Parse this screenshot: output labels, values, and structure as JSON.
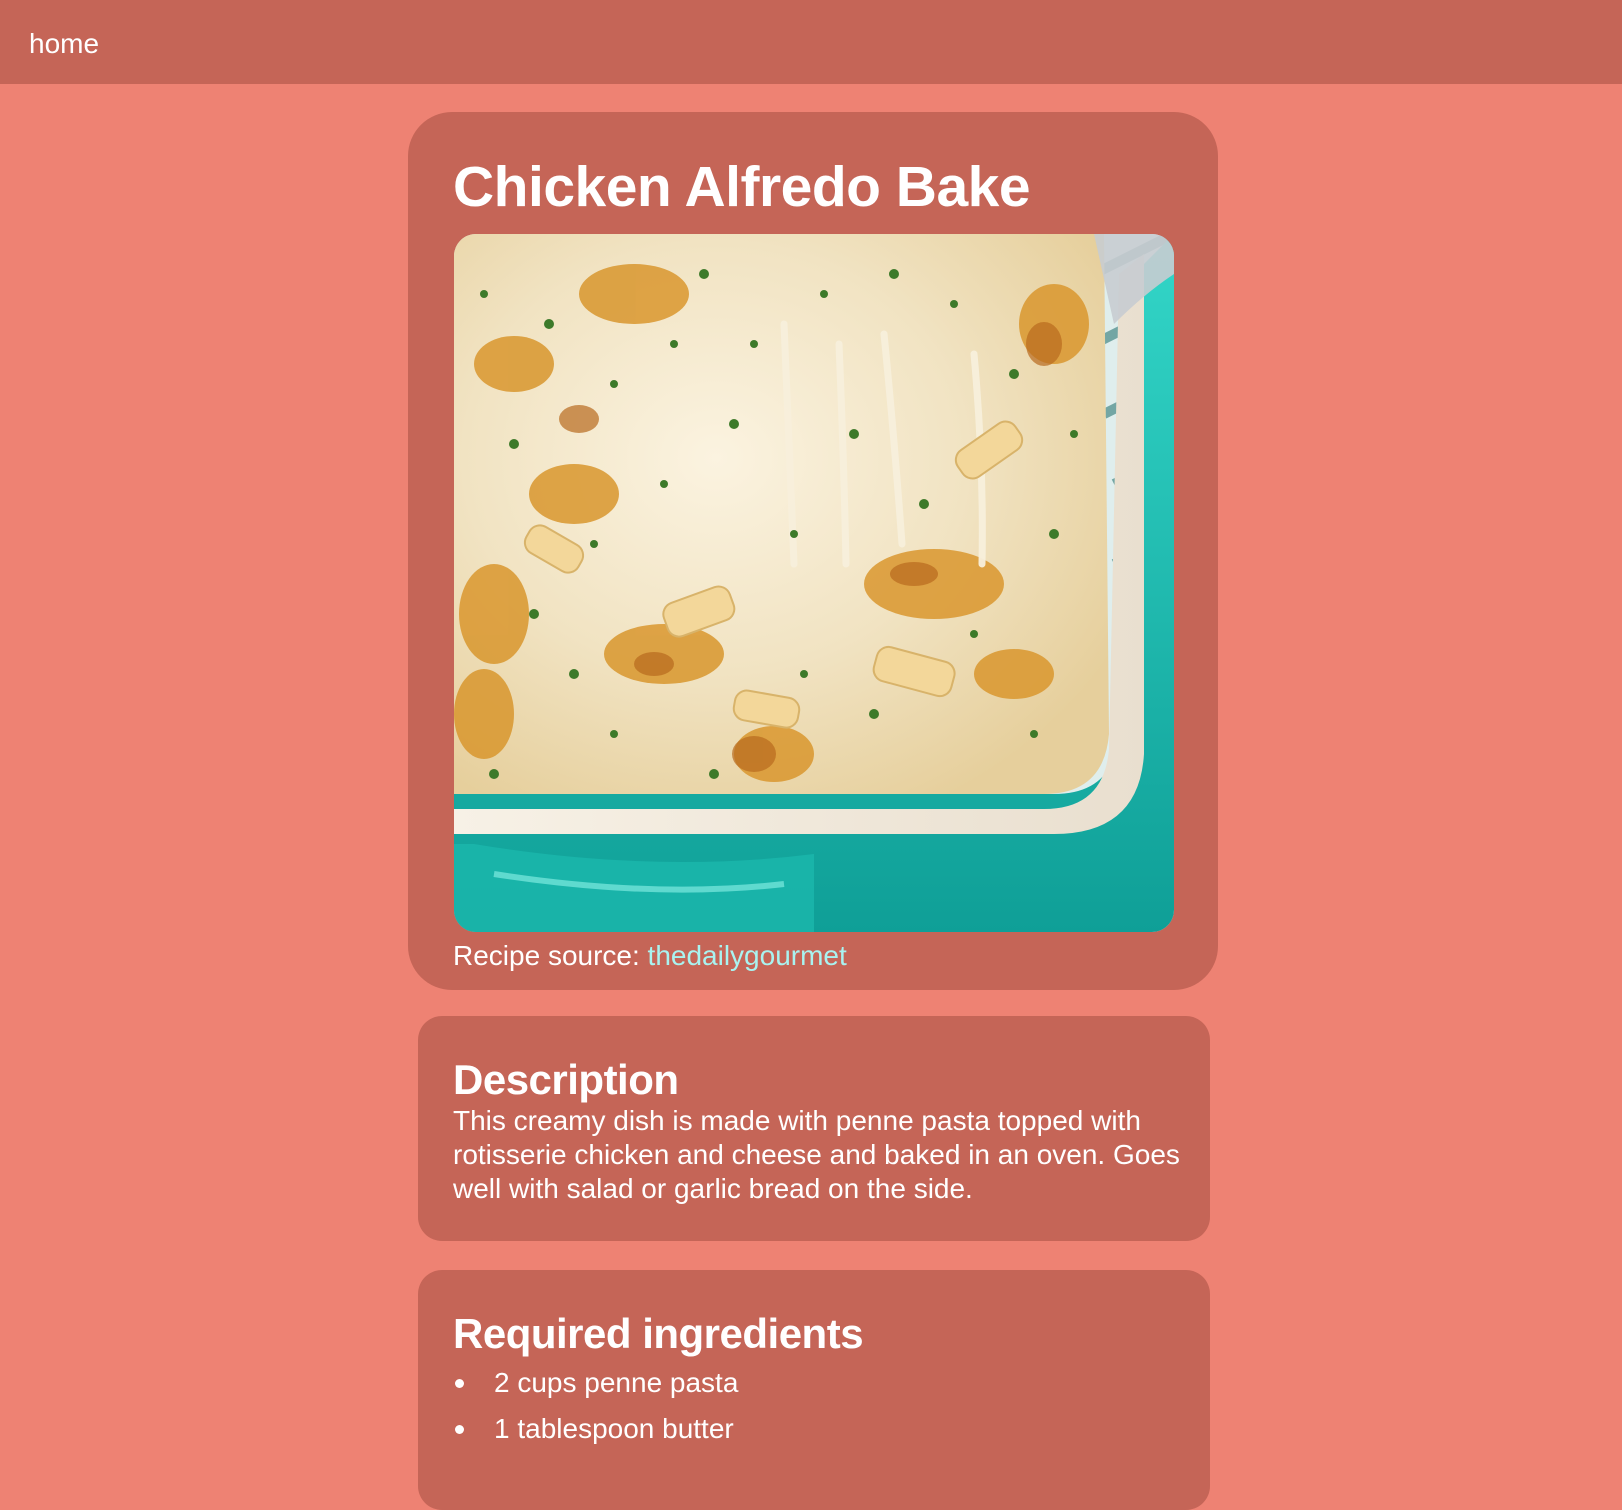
{
  "nav": {
    "home_label": "home"
  },
  "recipe": {
    "title": "Chicken Alfredo Bake",
    "image_alt": "Chicken Alfredo Bake",
    "source_prefix": "Recipe source: ",
    "source_link_text": "thedailygourmet"
  },
  "description": {
    "heading": "Description",
    "text": "This creamy dish is made with penne pasta topped with rotisserie chicken and cheese and baked in an oven. Goes well with salad or garlic bread on the side."
  },
  "ingredients": {
    "heading": "Required ingredients",
    "items": [
      "2 cups penne pasta",
      "1 tablespoon butter"
    ]
  },
  "colors": {
    "page_background": "#ee8273",
    "card_background": "#c56557",
    "text": "#ffffff",
    "link": "#a9f3f0"
  }
}
